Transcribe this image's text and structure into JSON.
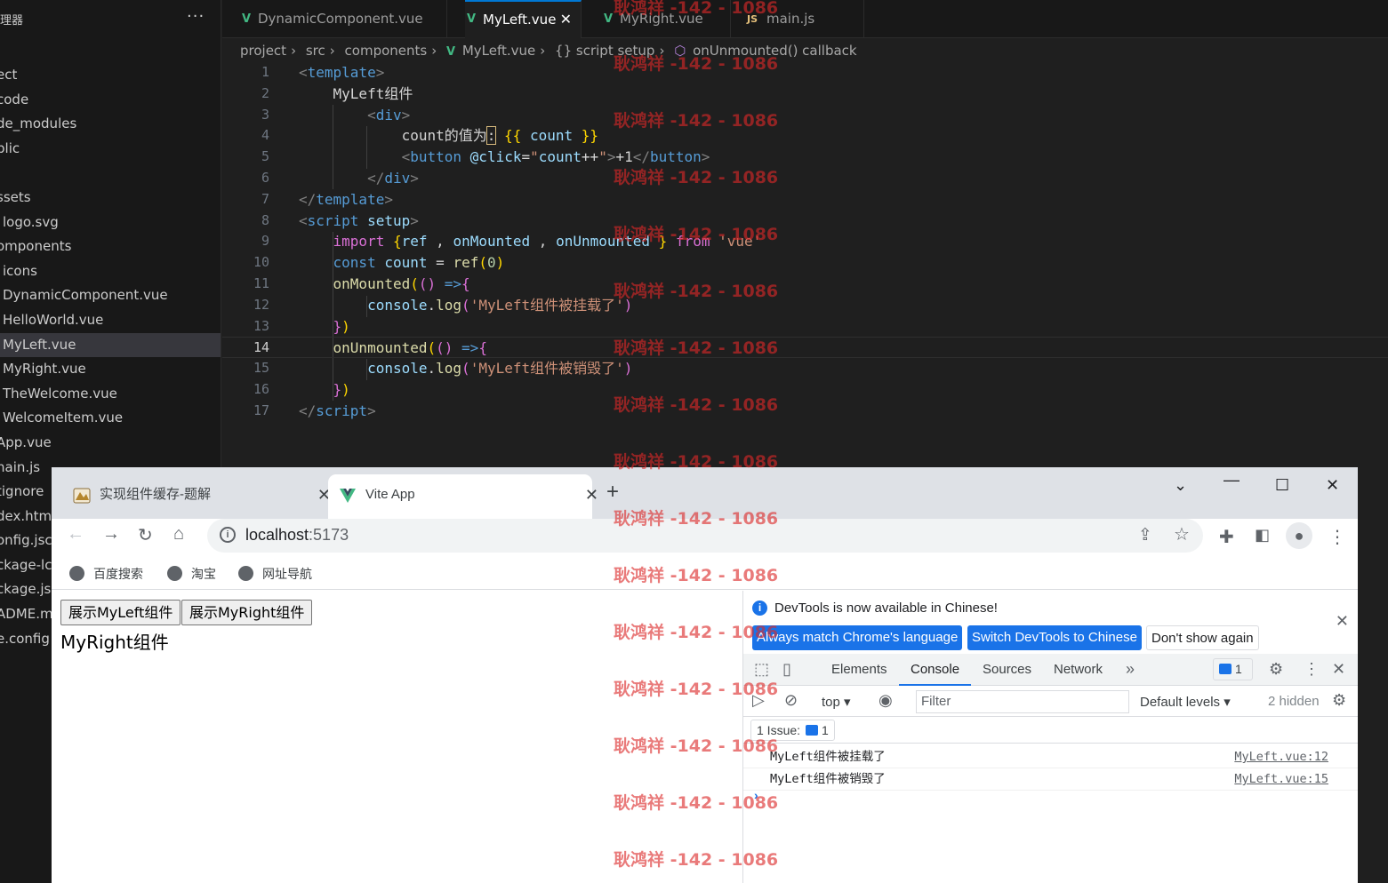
{
  "sidebar": {
    "title": "理器",
    "items": [
      {
        "label": "ect",
        "indent": 0
      },
      {
        "label": "code",
        "indent": 0
      },
      {
        "label": "de_modules",
        "indent": 0
      },
      {
        "label": "blic",
        "indent": 0
      },
      {
        "label": ":",
        "indent": 0
      },
      {
        "label": "ssets",
        "indent": 0
      },
      {
        "label": "logo.svg",
        "indent": 1
      },
      {
        "label": "omponents",
        "indent": 0
      },
      {
        "label": "icons",
        "indent": 1
      },
      {
        "label": "DynamicComponent.vue",
        "indent": 1
      },
      {
        "label": "HelloWorld.vue",
        "indent": 1
      },
      {
        "label": "MyLeft.vue",
        "indent": 1,
        "selected": true
      },
      {
        "label": "MyRight.vue",
        "indent": 1
      },
      {
        "label": "TheWelcome.vue",
        "indent": 1
      },
      {
        "label": "WelcomeItem.vue",
        "indent": 1
      },
      {
        "label": "App.vue",
        "indent": 0
      },
      {
        "label": "nain.js",
        "indent": 0
      },
      {
        "label": "tignore",
        "indent": 0
      },
      {
        "label": "dex.html",
        "indent": 0
      },
      {
        "label": "onfig.jsc",
        "indent": 0
      },
      {
        "label": "ckage-lc",
        "indent": 0
      },
      {
        "label": "ckage.js",
        "indent": 0
      },
      {
        "label": "ADME.m",
        "indent": 0
      },
      {
        "label": "e.config",
        "indent": 0
      }
    ]
  },
  "editor_tabs": [
    {
      "label": "DynamicComponent.vue",
      "icon": "vue-icon",
      "active": false
    },
    {
      "label": "MyLeft.vue",
      "icon": "vue-icon",
      "active": true
    },
    {
      "label": "MyRight.vue",
      "icon": "vue-icon",
      "active": false
    },
    {
      "label": "main.js",
      "icon": "js-icon",
      "active": false
    }
  ],
  "breadcrumb": [
    "project",
    "src",
    "components",
    "MyLeft.vue",
    "{} script setup",
    "onUnmounted() callback"
  ],
  "code": {
    "current_line": 14,
    "line_numbers": [
      "1",
      "2",
      "3",
      "4",
      "5",
      "6",
      "7",
      "8",
      "9",
      "10",
      "11",
      "12",
      "13",
      "14",
      "15",
      "16",
      "17"
    ]
  },
  "watermark": "耿鸿祥 -142 - 1086",
  "chrome": {
    "tabs": [
      {
        "label": "实现组件缓存-题解",
        "active": false
      },
      {
        "label": "Vite App",
        "active": true
      }
    ],
    "url_host": "localhost",
    "url_port": ":5173",
    "bookmarks": [
      "百度搜索",
      "淘宝",
      "网址导航"
    ],
    "page": {
      "buttons": [
        "展示MyLeft组件",
        "展示MyRight组件"
      ],
      "content_text": "MyRight组件"
    }
  },
  "devtools": {
    "banner_message": "DevTools is now available in Chinese!",
    "banner_buttons": [
      "Always match Chrome's language",
      "Switch DevTools to Chinese",
      "Don't show again"
    ],
    "tabs": [
      "Elements",
      "Console",
      "Sources",
      "Network"
    ],
    "active_tab": "Console",
    "issues_count": "1",
    "context": "top",
    "filter_placeholder": "Filter",
    "levels": "Default levels",
    "hidden_count": "2 hidden",
    "issue_bar_label": "1 Issue:",
    "issue_bar_count": "1",
    "logs": [
      {
        "message": "MyLeft组件被挂载了",
        "source": "MyLeft.vue:12"
      },
      {
        "message": "MyLeft组件被销毁了",
        "source": "MyLeft.vue:15"
      }
    ]
  }
}
